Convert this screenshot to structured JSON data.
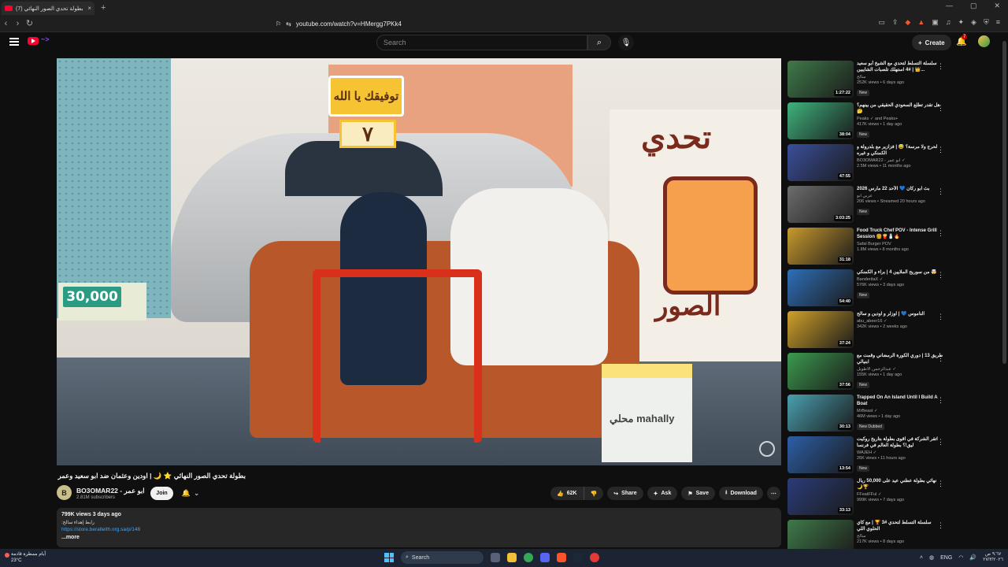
{
  "browser": {
    "tab_title": "(7) بطولة تحدي الصور النهائي",
    "tab_close": "×",
    "newtab": "+",
    "url": "youtube.com/watch?v=HMergg7PKk4",
    "win_min": "—",
    "win_max": "▢",
    "win_close": "✕"
  },
  "header": {
    "search_placeholder": "Search",
    "create_label": "Create",
    "notif_count": "7"
  },
  "video": {
    "sign_text": "توفيقك يا الله",
    "sign_number": "٧",
    "price_text": "30,000",
    "poster_top": "تحدي",
    "poster_bottom": "الصور",
    "box_label": "محلي mahally",
    "title": "بطولة تحدي الصور النهائي ⭐ 🌙 | اودين وعثمان ضد ابو سعيد وعمر"
  },
  "channel": {
    "avatar_text": "B",
    "name": "BO3OMAR22 - ابو عمر",
    "subscribers": "2.81M subscribers",
    "join_label": "Join",
    "bell": "🔔",
    "chevron": "⌄"
  },
  "actions": {
    "likes": "62K",
    "share": "Share",
    "ask": "Ask",
    "save": "Save",
    "download": "Download"
  },
  "description": {
    "stats": "799K views  3 days ago",
    "line1": "رابط إهداء سالح:",
    "link": "https://store.beralleith.org.sa/p/148",
    "more": "...more"
  },
  "sidebar": [
    {
      "title": "سلسلة التسلط لتحدي مع الشيخ أبو سعيد 👑 | #4 استهلك تلصبات الشايبين...",
      "channel": "سالح",
      "meta": "252K views • 6 days ago",
      "badge": "New",
      "duration": "1:27:22",
      "color": "#3f7a4a"
    },
    {
      "title": "هل تقدر تطلع السعودي الحقيقي من بينهم؟ 🤔",
      "channel": "Peaks ✓ and Peaks+",
      "meta": "417K views • 1 day ago",
      "badge": "New",
      "duration": "38:04",
      "color": "#3fb37d"
    },
    {
      "title": "لحرج ولا مرسة؟ 😅 | فزازير مع بلدرولة و الكمنكي و غيره",
      "channel": "BO3OMAR22 - ابو عمر ✓",
      "meta": "2.5M views • 11 months ago",
      "badge": "",
      "duration": "47:55",
      "color": "#3a4f9c"
    },
    {
      "title": "بث ابو ركان 💙 الأحد 22 مارس 2026",
      "channel": "عربي ابو",
      "meta": "206 views • Streamed 20 hours ago",
      "badge": "New",
      "duration": "3:03:25",
      "color": "#6d6d6d"
    },
    {
      "title": "Food Truck Chef POV - Intense Grill Session 🍔🍟🧂🔥",
      "channel": "Safal Burger POV",
      "meta": "1.8M views • 8 months ago",
      "badge": "",
      "duration": "31:18",
      "color": "#c99a2e"
    },
    {
      "title": "من سوريح الملايين 4 | براء و الكمنكي 🤯",
      "channel": "BanderitaX ✓",
      "meta": "576K views • 3 days ago",
      "badge": "New",
      "duration": "54:40",
      "color": "#2e6fb8"
    },
    {
      "title": "الناموس 💙 | اوزلر و اودين و سالح",
      "channel": "abu_abeer16 ✓",
      "meta": "342K views • 2 weeks ago",
      "badge": "",
      "duration": "37:24",
      "color": "#d0a12a"
    },
    {
      "title": "طريق 13 | دوري الكورة الرمضاني وقمت مع ابنيالي",
      "channel": "عبدالرحمن الاطويل ✓",
      "meta": "155K views • 1 day ago",
      "badge": "New",
      "duration": "37:56",
      "color": "#3c9a4f"
    },
    {
      "title": "Trapped On An Island Until I Build A Boat",
      "channel": "MrBeast ✓",
      "meta": "46M views • 1 day ago",
      "badge": "New  Dubbed",
      "duration": "30:13",
      "color": "#4aa0b0"
    },
    {
      "title": "اتقر الشركة في اقوى بطولة بتاريخ روكيت ليق!؟ بطولة العالم في فرنسا",
      "channel": "WAJEH ✓",
      "meta": "26K views • 11 hours ago",
      "badge": "New",
      "duration": "13:54",
      "color": "#2c5fa8"
    },
    {
      "title": "نهائي بطولة عطني عيد على 50,000 ريال 🌙🏆",
      "channel": "FFeatFFul ✓",
      "meta": "999K views • 7 days ago",
      "badge": "",
      "duration": "33:13",
      "color": "#2a3c7a"
    },
    {
      "title": "سلسلة التسلط لتحدي #3 🏆 | مع كاي الحلوي اللي",
      "channel": "سالح",
      "meta": "217K views • 8 days ago",
      "badge": "",
      "duration": "",
      "color": "#3f7a4a"
    }
  ],
  "taskbar": {
    "weather_text": "أيام ممطرة قادمة",
    "temp": "23°C",
    "search": "Search",
    "lang": "ENG",
    "time": "٩:٦٧ ص",
    "date": "٢٧/٣/٢٠٢٦"
  }
}
